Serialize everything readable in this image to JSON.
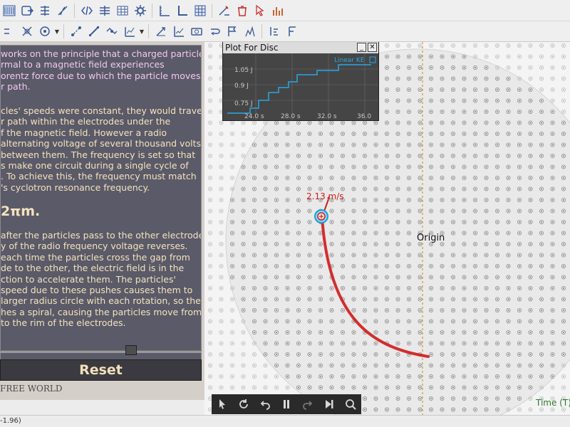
{
  "toolbar1": {
    "items": [
      "graph-tool-icon",
      "body-export-icon",
      "body-add-icon",
      "scale-tool-icon",
      "code-tool-icon",
      "data-tool-icon",
      "table-tool-icon",
      "settings-tool-icon",
      "axis-tool-icon",
      "origin-tool-icon",
      "grid-tool-icon",
      "ruler-tool-icon",
      "delete-tool-icon",
      "pointer-tool-icon",
      "chart-tool-icon"
    ]
  },
  "toolbar2": {
    "items": [
      "link-tool-icon",
      "shape-tool-icon",
      "target-tool-icon",
      "node-tool-icon",
      "line-tool-icon",
      "path-tool-icon",
      "plot-view-icon",
      "vector-tool-icon",
      "graph-view-icon",
      "camera-tool-icon",
      "loop-tool-icon",
      "record-tool-icon",
      "trace-tool-icon",
      "step-tool-icon",
      "format-tool-icon"
    ]
  },
  "description": {
    "para1": [
      "works on the principle that a charged particle",
      "rmal to a magnetic field experiences",
      "orentz force due to which the particle moves",
      "r path."
    ],
    "para2": [
      "cles' speeds were constant, they would travel",
      "r path within the electrodes under the",
      "f the magnetic field. However a radio",
      "alternating voltage of several thousand volts",
      "between them. The frequency is set so that",
      "s make one circuit during a single cycle of",
      ". To achieve this, the frequency must match",
      "'s cyclotron resonance frequency."
    ],
    "heading": "2πm.",
    "para3": [
      "after the particles pass to the other electrode,",
      "y of the radio frequency voltage reverses.",
      "each time the particles cross the gap from",
      "de to the other, the electric field is in the",
      "ction to accelerate them. The particles'",
      "speed due to these pushes causes them to",
      "larger radius circle with each rotation, so the",
      "hes a spiral, causing the particles move from",
      "to the rim of the electrodes."
    ]
  },
  "controls": {
    "slider_value": 0.66,
    "reset_label": "Reset",
    "footer": "FREE WORLD"
  },
  "plot": {
    "title": "Plot For Disc",
    "minimize_label": "_",
    "close_label": "✕",
    "legend": "Linear KE",
    "y_ticks": [
      "1.05 J",
      "0.9 J",
      "0.75 J"
    ],
    "x_ticks": [
      "24.0 s",
      "28.0 s",
      "32.0 s",
      "36.0"
    ]
  },
  "simulation": {
    "velocity_label": "2.13 m/s",
    "origin_label": "Origin",
    "axis_label": "Time (T)"
  },
  "colors": {
    "accent_red": "#d21a1a",
    "particle_blue": "#1aa0d8",
    "plot_line": "#2aa6e6",
    "text_pink": "#f2c7f2",
    "text_cream": "#f4e3bd",
    "gap_orange": "#d8933a"
  },
  "status_bar": {
    "text": "-1.96)"
  }
}
